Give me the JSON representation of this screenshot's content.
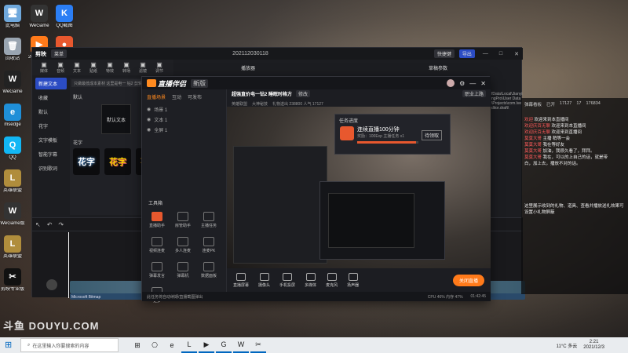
{
  "desktop": {
    "icons": [
      {
        "label": "此电脑",
        "glyph": "🖥",
        "color": "#6fa8dc"
      },
      {
        "label": "回收站",
        "glyph": "🗑",
        "color": "#9aa5b1"
      },
      {
        "label": "WeGame",
        "glyph": "W",
        "color": "#222"
      },
      {
        "label": "msedge",
        "glyph": "e",
        "color": "#1f8fd8"
      },
      {
        "label": "QQ",
        "glyph": "Q",
        "color": "#12b7f5"
      },
      {
        "label": "英雄联盟",
        "glyph": "L",
        "color": "#b08d3c"
      },
      {
        "label": "WeGame版",
        "glyph": "W",
        "color": "#333"
      },
      {
        "label": "英雄联盟",
        "glyph": "L",
        "color": "#b08d3c"
      },
      {
        "label": "剪映专业版",
        "glyph": "✂",
        "color": "#111"
      }
    ],
    "icons_col2": [
      {
        "label": "WeGame",
        "glyph": "W",
        "color": "#333"
      },
      {
        "label": "QQ截图",
        "glyph": "K",
        "color": "#2b7ef5"
      },
      {
        "label": "2021120...",
        "glyph": "▶",
        "color": "#ff7a1a"
      },
      {
        "label": "直播伴侣",
        "glyph": "●",
        "color": "#e8582e"
      }
    ],
    "watermark": "斗鱼 DOUYU.COM"
  },
  "editor": {
    "app_name": "剪映",
    "menu_label": "菜单",
    "project_title": "202112030118",
    "export_label": "导出",
    "shortcut_label": "快捷键",
    "toolbar": [
      "媒体",
      "音频",
      "文本",
      "贴纸",
      "特效",
      "转场",
      "滤镜",
      "调节"
    ],
    "sidebar": [
      "新建文本",
      "收藏",
      "默认",
      "花字",
      "文字模板",
      "智能字幕",
      "识别歌词"
    ],
    "search_placeholder": "只做最低成本素材 这里是电一 钻2 剪辑师",
    "default_text": "默认文本",
    "section_default": "默认",
    "section_fancy": "花字",
    "fancy_sample": "花字",
    "player_label": "播放器",
    "draft_label": "草稿参数",
    "path_text": "fData\\Local\\JianyingPro\\User Data\\Projects\\com.lveditor.draft\\",
    "clip_label": "Microsoft Bitmap"
  },
  "live": {
    "app_name": "直播伴侣",
    "version": "新版",
    "tabs": [
      "直播场景",
      "互动",
      "可发布"
    ],
    "scenes": [
      "场景 1",
      "文本 1",
      "全屏 1"
    ],
    "tools_title": "工具箱",
    "tools": [
      "直播助手",
      "房管助手",
      "主播任务",
      "视频连麦",
      "多人连麦",
      "连麦PK",
      "弹幕发言",
      "弹幕机",
      "数据面板",
      "更多"
    ],
    "room_title": "超强直价电一钻2 睡眠时格方",
    "room_tag": "修改",
    "room_cat": "英雄联盟",
    "room_type": "大神秘技",
    "room_stats": "礼物送出 238800 人气 17127",
    "room_online": "职业上路",
    "bottom_tools": [
      "直播屏幕",
      "摄像头",
      "手机投屏",
      "多媒体",
      "麦克风",
      "扬声器"
    ],
    "start_button": "关闭直播",
    "status_text": "此任务将自动续期/直播截图弹出",
    "status_metrics": "CPU 46%  内存 47%",
    "time": "01:42:45",
    "toast_title": "任务进度",
    "toast_item": "连续直播100分钟",
    "toast_sub": "奖励：100Exp 主播任务 x1",
    "toast_btn": "待领取",
    "toast_progress": 0.96
  },
  "chat": {
    "header": [
      "弹幕看板",
      "已开",
      "17127",
      "17",
      "176834"
    ],
    "lines": [
      {
        "name": "欢迎 ",
        "text": "欢迎来到本直播间"
      },
      {
        "name": "欢迎庆百无聊 ",
        "text": "欢迎来到本直播间"
      },
      {
        "name": "欢迎庆百无聊 ",
        "text": "欢迎来到直播间"
      },
      {
        "name": "莫莫大哥 ",
        "text": "主播 稍等一会"
      },
      {
        "name": "莫莫大哥 ",
        "text": "我在等好友"
      },
      {
        "name": "莫莫大哥 ",
        "text": "加油，我很久看了，拜拜。"
      },
      {
        "name": "莫莫大哥 ",
        "text": "我在，可以的上自己的话，就是带"
      },
      {
        "name": "",
        "text": "白，加上去，播放不对的话。"
      }
    ],
    "notice": "这里展示收到的礼物、道具、查看并播放送礼效果可设置小礼物屏蔽"
  },
  "taskbar": {
    "search_placeholder": "在这里输入你要搜索的内容",
    "weather": "11°C 多云",
    "time": "2:21",
    "date": "2021/12/3",
    "apps": [
      "⊞",
      "⎔",
      "e",
      "L",
      "▶",
      "G",
      "W",
      "✂"
    ]
  }
}
